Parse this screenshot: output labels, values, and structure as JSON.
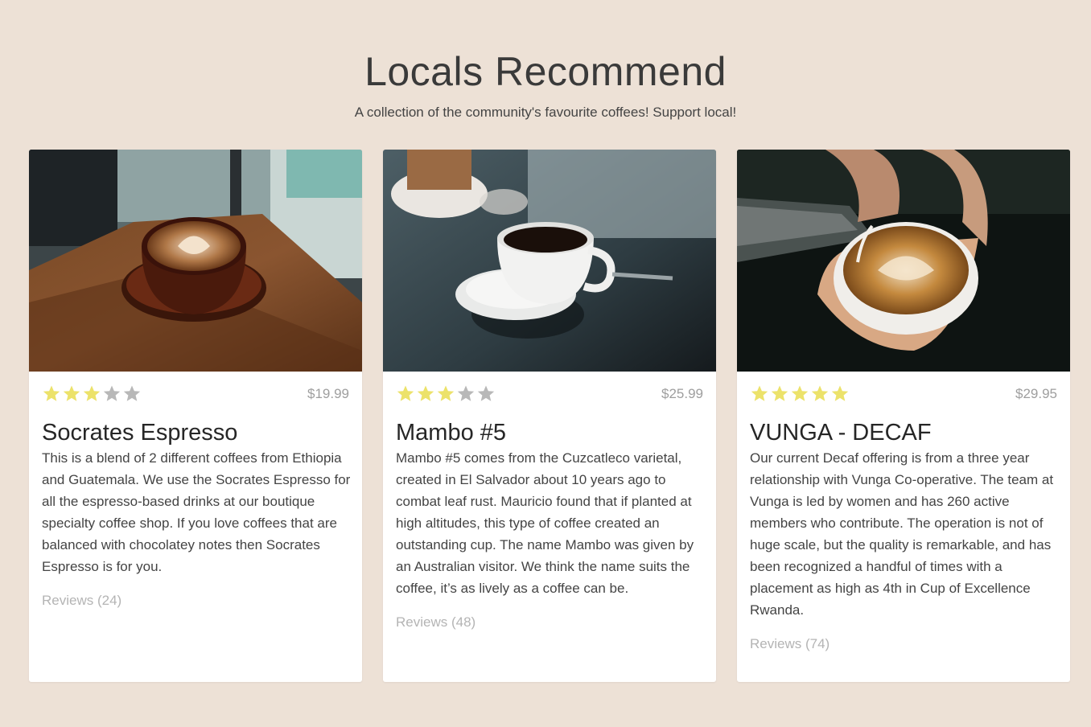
{
  "header": {
    "title": "Locals Recommend",
    "subtitle": "A collection of the community's favourite coffees! Support local!"
  },
  "colors": {
    "background": "#ede1d6",
    "star_filled": "#ece26a",
    "star_empty": "#b8b8b8",
    "price": "#9e9e9e",
    "reviews": "#b4b4b4"
  },
  "cards": [
    {
      "image": "latte-art-cup-on-wooden-table",
      "rating": 3,
      "max_rating": 5,
      "price": "$19.99",
      "name": "Socrates Espresso",
      "description": "This is a blend of 2 different coffees from Ethiopia and Guatemala. We use the Socrates Espresso for all the espresso-based drinks at our boutique specialty coffee shop. If you love coffees that are balanced with chocolatey notes then Socrates Espresso is for you.",
      "reviews": "Reviews (24)"
    },
    {
      "image": "white-coffee-cup-on-saucer",
      "rating": 3,
      "max_rating": 5,
      "price": "$25.99",
      "name": "Mambo #5",
      "description": "Mambo #5 comes from the Cuzcatleco varietal, created in El Salvador about 10 years ago to combat leaf rust. Mauricio found that if planted at high altitudes, this type of coffee created an outstanding cup. The name Mambo was given by an Australian visitor. We think the name suits the coffee, it’s as lively as a coffee can be.",
      "reviews": "Reviews (48)"
    },
    {
      "image": "pouring-latte-art",
      "rating": 5,
      "max_rating": 5,
      "price": "$29.95",
      "name": "VUNGA - DECAF",
      "description": "Our current Decaf offering is from a three year relationship with Vunga Co-operative. The team at Vunga is led by women and has 260 active members who contribute. The operation is not of huge scale, but the quality is remarkable, and has been recognized a handful of times with a placement as high as 4th in Cup of Excellence Rwanda.",
      "reviews": "Reviews (74)"
    }
  ]
}
